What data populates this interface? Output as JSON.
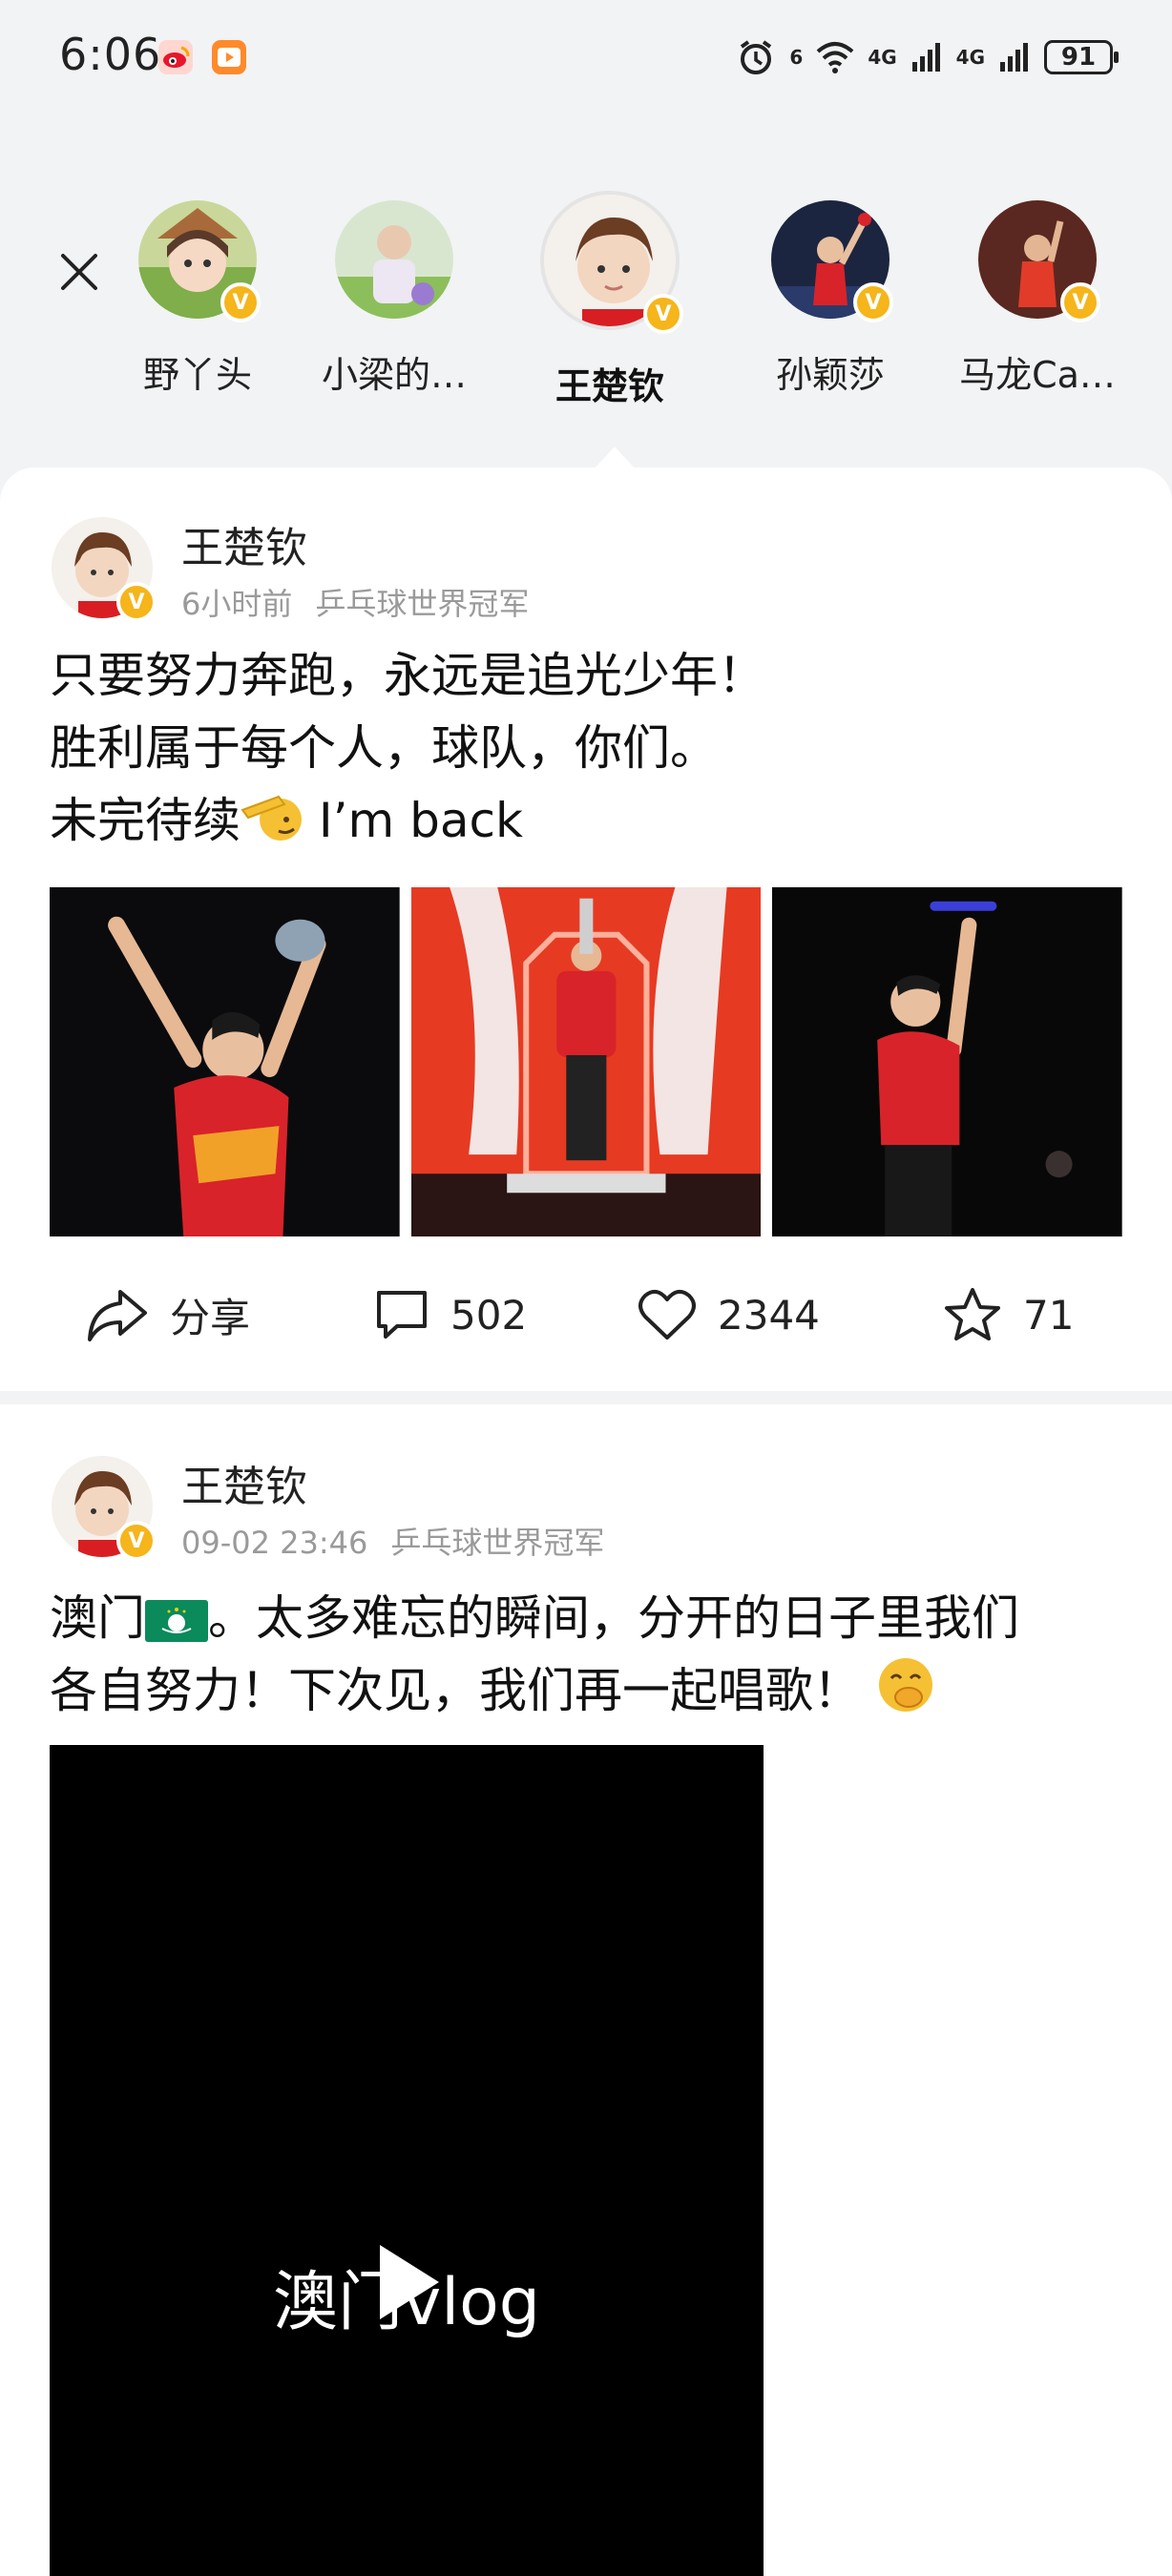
{
  "status_bar": {
    "time": "6:06",
    "battery": "91",
    "net_labels": [
      "6",
      "4G",
      "4G"
    ]
  },
  "stories": [
    {
      "name": "野丫头",
      "active": false
    },
    {
      "name": "小梁的…",
      "active": false
    },
    {
      "name": "王楚钦",
      "active": true
    },
    {
      "name": "孙颖莎",
      "active": false
    },
    {
      "name": "马龙Ca…",
      "active": false
    }
  ],
  "verified_badge": "V",
  "post1": {
    "author": "王楚钦",
    "time": "6小时前",
    "tag": "乒乓球世界冠军",
    "lines": [
      "只要努力奔跑，永远是追光少年！",
      "胜利属于每个人，球队，你们。",
      "未完待续"
    ],
    "line3_suffix": "I’m back",
    "actions": {
      "share": "分享",
      "comments": "502",
      "likes": "2344",
      "favorites": "71"
    }
  },
  "post2": {
    "author": "王楚钦",
    "time": "09-02 23:46",
    "tag": "乒乓球世界冠军",
    "line1_a": "澳门",
    "line1_b": "。太多难忘的瞬间，分开的日子里我们",
    "line2": "各自努力！下次见，我们再一起唱歌！",
    "video_title": "澳门vlog"
  },
  "icons": [
    "close-icon",
    "share-icon",
    "comment-icon",
    "like-icon",
    "favorite-icon",
    "play-icon",
    "verified-badge-icon"
  ],
  "colors": {
    "badge": "#f5b51b",
    "page_bg": "#f2f3f5",
    "card_bg": "#ffffff",
    "meta_text": "#9a9a9a",
    "video_bg": "#000000"
  }
}
